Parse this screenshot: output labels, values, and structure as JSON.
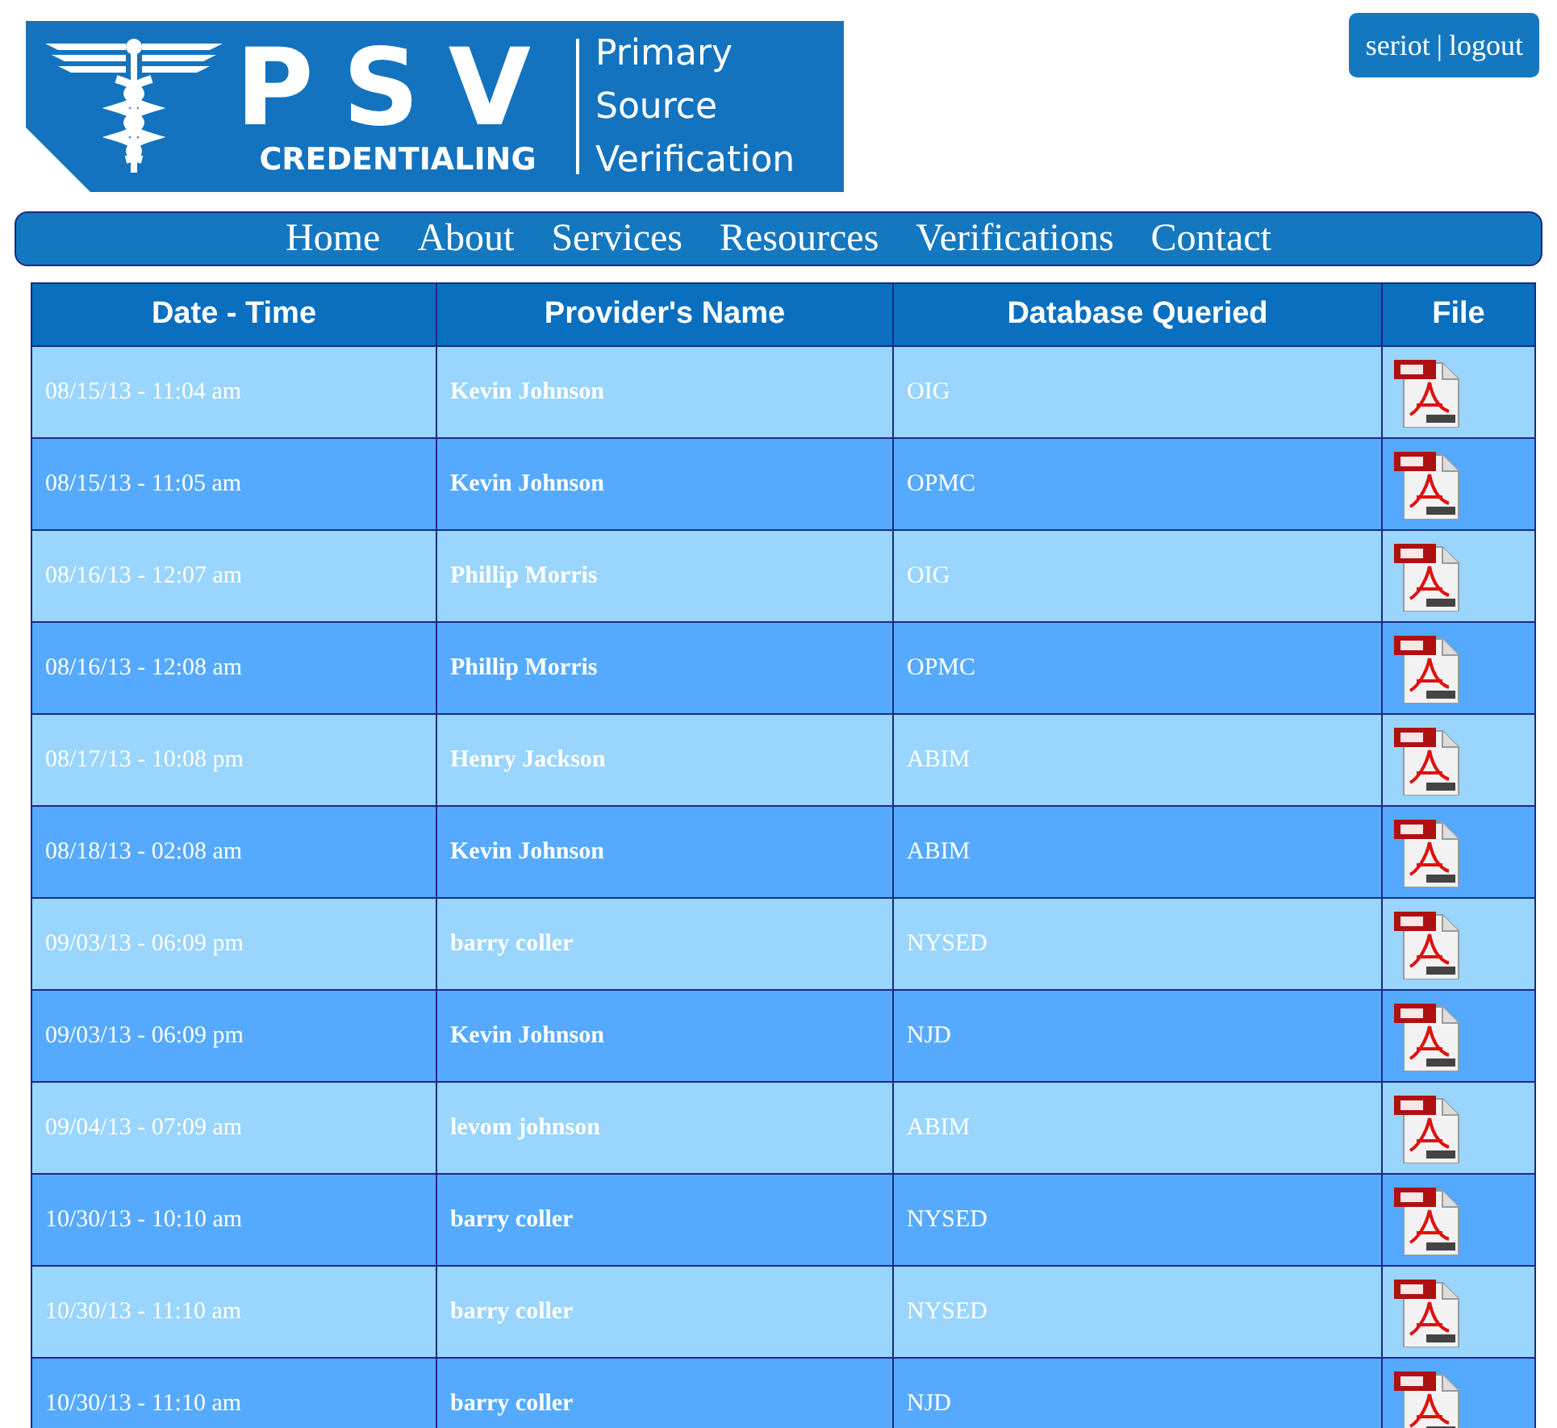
{
  "logo": {
    "big": "PSV",
    "sub": "CREDENTIALING",
    "lines": [
      "Primary",
      "Source",
      "Verification"
    ]
  },
  "user": {
    "name": "seriot",
    "separator": "|",
    "logout": "logout"
  },
  "nav": [
    "Home",
    "About",
    "Services",
    "Resources",
    "Verifications",
    "Contact"
  ],
  "table": {
    "columns": [
      "Date - Time",
      "Provider's Name",
      "Database Queried",
      "File"
    ],
    "rows": [
      {
        "time": "08/15/13 - 11:04 am",
        "provider": "Kevin Johnson",
        "database": "OIG"
      },
      {
        "time": "08/15/13 - 11:05 am",
        "provider": "Kevin Johnson",
        "database": "OPMC"
      },
      {
        "time": "08/16/13 - 12:07 am",
        "provider": "Phillip Morris",
        "database": "OIG"
      },
      {
        "time": "08/16/13 - 12:08 am",
        "provider": "Phillip Morris",
        "database": "OPMC"
      },
      {
        "time": "08/17/13 - 10:08 pm",
        "provider": "Henry Jackson",
        "database": "ABIM"
      },
      {
        "time": "08/18/13 - 02:08 am",
        "provider": "Kevin Johnson",
        "database": "ABIM"
      },
      {
        "time": "09/03/13 - 06:09 pm",
        "provider": "barry coller",
        "database": "NYSED"
      },
      {
        "time": "09/03/13 - 06:09 pm",
        "provider": "Kevin Johnson",
        "database": "NJD"
      },
      {
        "time": "09/04/13 - 07:09 am",
        "provider": "levom johnson",
        "database": "ABIM"
      },
      {
        "time": "10/30/13 - 10:10 am",
        "provider": "barry coller",
        "database": "NYSED"
      },
      {
        "time": "10/30/13 - 11:10 am",
        "provider": "barry coller",
        "database": "NYSED"
      },
      {
        "time": "10/30/13 - 11:10 am",
        "provider": "barry coller",
        "database": "NJD"
      }
    ]
  }
}
